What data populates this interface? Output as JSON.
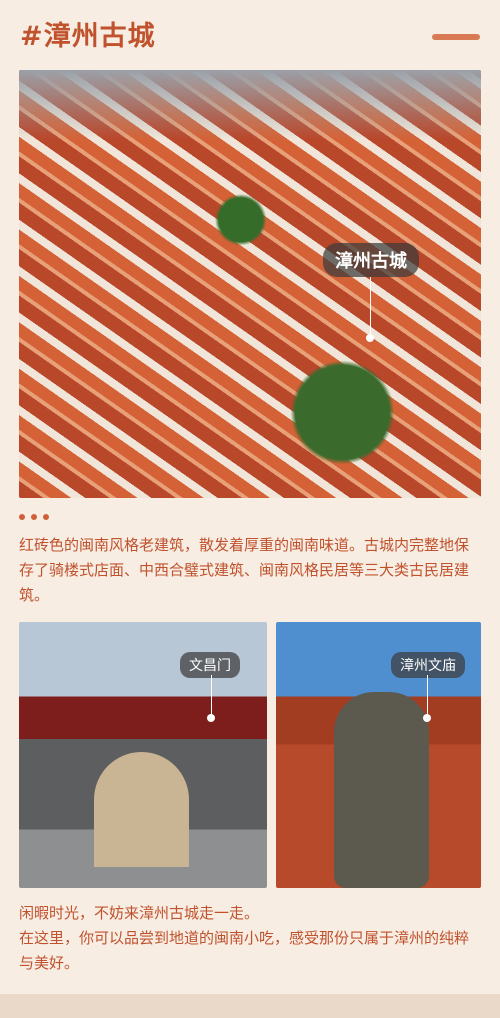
{
  "header": {
    "title": "#漳州古城"
  },
  "hero": {
    "tag": "漳州古城"
  },
  "intro": {
    "text": "红砖色的闽南风格老建筑，散发着厚重的闽南味道。古城内完整地保存了骑楼式店面、中西合璧式建筑、闽南风格民居等三大类古民居建筑。"
  },
  "photos": {
    "left_tag": "文昌门",
    "right_tag": "漳州文庙"
  },
  "outro": {
    "line1": "闲暇时光，不妨来漳州古城走一走。",
    "line2": "在这里，你可以品尝到地道的闽南小吃，感受那份只属于漳州的纯粹与美好。"
  },
  "colors": {
    "accent": "#c0522e",
    "background": "#f7ede2"
  }
}
